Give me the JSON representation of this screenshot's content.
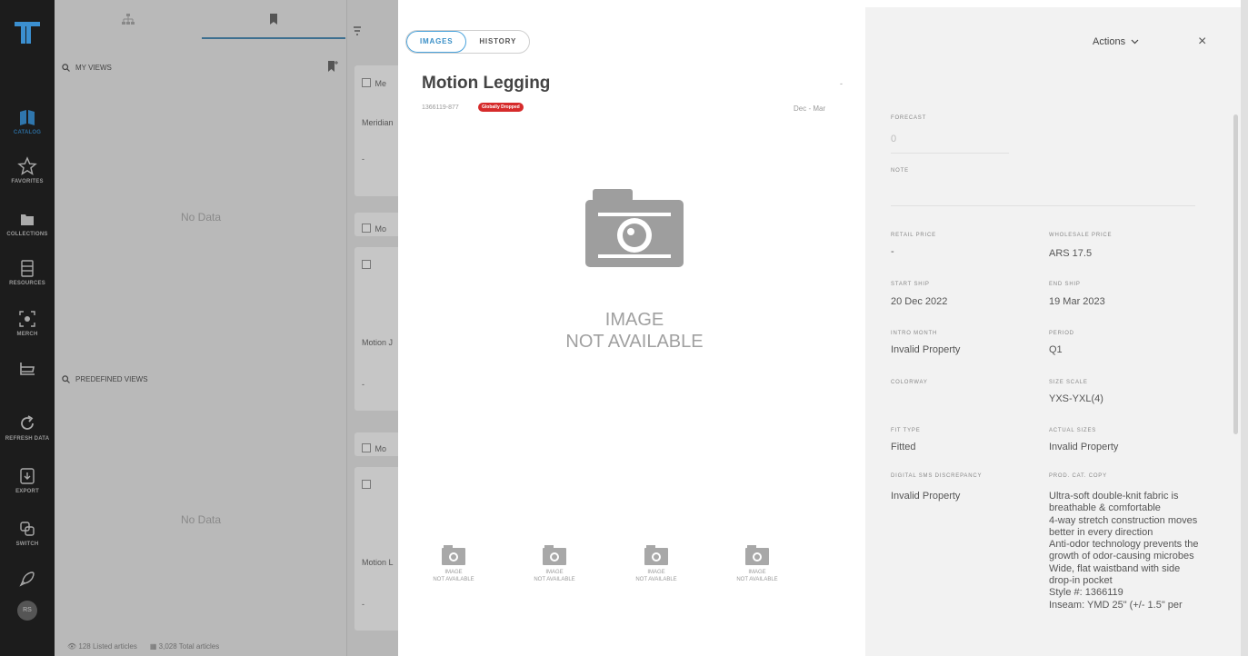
{
  "nav": {
    "items": [
      {
        "label": "CATALOG"
      },
      {
        "label": "FAVORITES"
      },
      {
        "label": "COLLECTIONS"
      },
      {
        "label": "RESOURCES"
      },
      {
        "label": "MERCH"
      },
      {
        "label": "REFRESH DATA"
      },
      {
        "label": "EXPORT"
      },
      {
        "label": "SWITCH"
      }
    ],
    "avatar": "RS",
    "accent": "#2b6b9c"
  },
  "views": {
    "my_views": "MY VIEWS",
    "predefined_views": "PREDEFINED VIEWS",
    "no_data": "No Data",
    "footer_listed": "128 Listed articles",
    "footer_total": "3,028 Total articles"
  },
  "cards": {
    "c1_title": "Me",
    "c1_sub": "Meridian",
    "c2_title": "Mo",
    "c2_sub": "Motion J",
    "c3_title": "Mo",
    "c3_sub": "Motion L",
    "dash": "-"
  },
  "image_panel": {
    "tabs": [
      "IMAGES",
      "HISTORY"
    ],
    "title": "Motion Legging",
    "dash": "-",
    "sku": "1366119-877",
    "badge": "Globally Dropped",
    "badge_color": "#d62b2b",
    "season": "Dec - Mar",
    "placeholder_line1": "IMAGE",
    "placeholder_line2": "NOT AVAILABLE",
    "thumb_line1": "IMAGE",
    "thumb_line2": "NOT AVAILABLE"
  },
  "details": {
    "actions": "Actions",
    "close": "×",
    "forecast_label": "FORECAST",
    "forecast_value": "0",
    "note_label": "NOTE",
    "retail_price_label": "RETAIL PRICE",
    "retail_price_value": "-",
    "wholesale_price_label": "WHOLESALE PRICE",
    "wholesale_price_value": "ARS 17.5",
    "start_ship_label": "START SHIP",
    "start_ship_value": "20 Dec 2022",
    "end_ship_label": "END SHIP",
    "end_ship_value": "19 Mar 2023",
    "intro_month_label": "INTRO MONTH",
    "intro_month_value": "Invalid Property",
    "period_label": "PERIOD",
    "period_value": "Q1",
    "colorway_label": "COLORWAY",
    "size_scale_label": "SIZE SCALE",
    "size_scale_value": "YXS-YXL(4)",
    "fit_type_label": "FIT TYPE",
    "fit_type_value": "Fitted",
    "actual_sizes_label": "ACTUAL SIZES",
    "actual_sizes_value": "Invalid Property",
    "digital_sms_label": "DIGITAL SMS DISCREPANCY",
    "digital_sms_value": "Invalid Property",
    "prod_cat_copy_label": "PROD. CAT. COPY",
    "prod_cat_copy_value": "Ultra-soft double-knit fabric is breathable & comfortable\n4-way stretch construction moves better in every direction\nAnti-odor technology prevents the growth of odor-causing microbes\nWide, flat waistband with side drop-in pocket\nStyle #: 1366119\nInseam: YMD 25\" (+/- 1.5\" per"
  }
}
